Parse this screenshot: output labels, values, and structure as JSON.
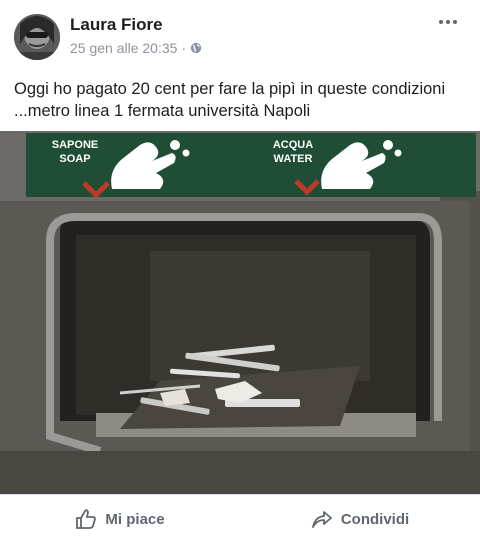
{
  "post": {
    "author": "Laura Fiore",
    "timestamp": "25 gen alle 20:35",
    "separator": "·",
    "audience_icon": "globe-icon",
    "text": "Oggi ho pagato 20 cent per fare la pipì in queste condizioni ...metro linea 1 fermata università Napoli"
  },
  "photo": {
    "sign": {
      "left_label_it": "SAPONE",
      "left_label_en": "SOAP",
      "right_label_it": "ACQUA",
      "right_label_en": "WATER"
    }
  },
  "actions": {
    "like_label": "Mi piace",
    "share_label": "Condividi"
  },
  "colors": {
    "sign_green": "#1f4d35",
    "arrow_red": "#c0392b",
    "text_primary": "#1c1e21",
    "text_secondary": "#8d949e",
    "action_gray": "#606770"
  }
}
